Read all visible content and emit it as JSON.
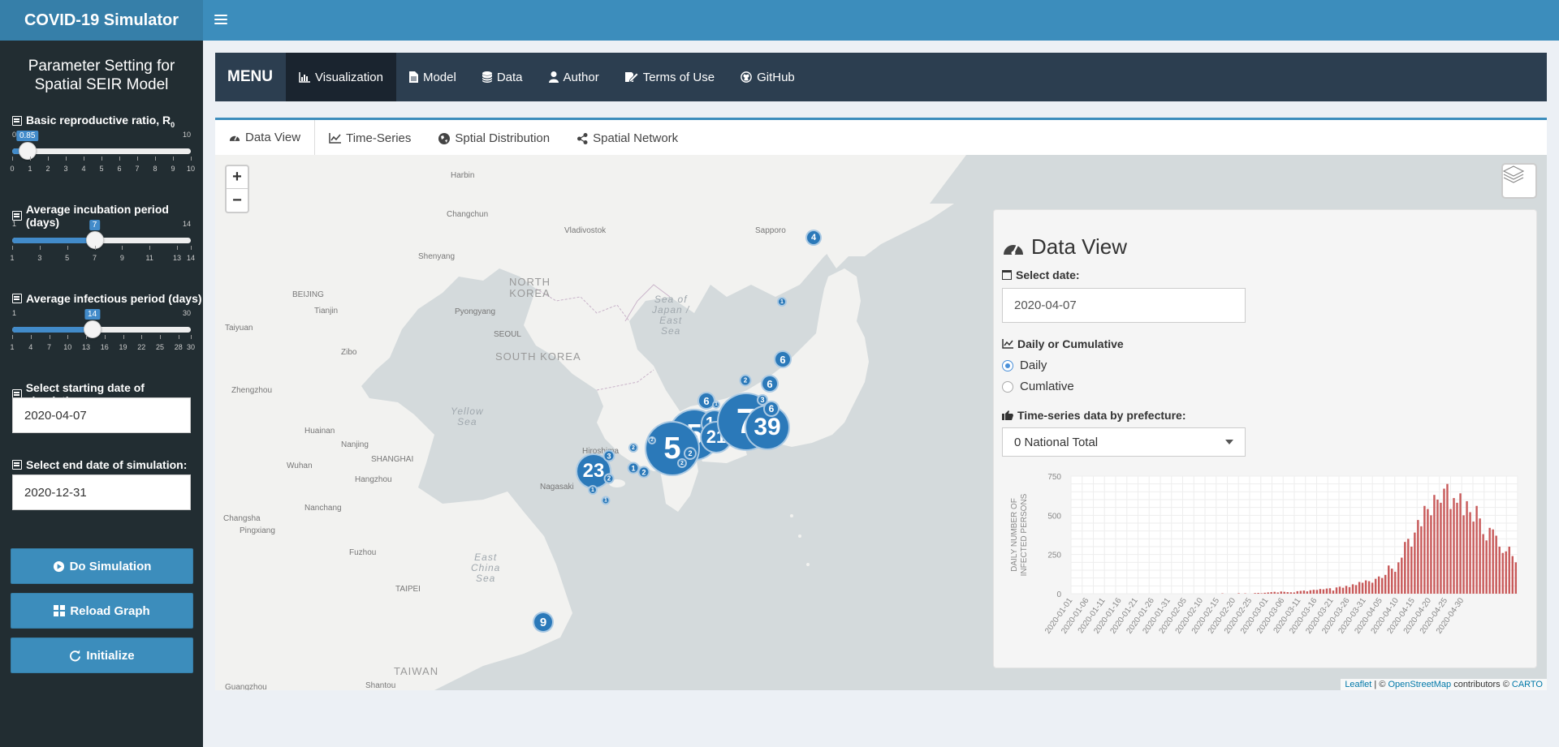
{
  "app": {
    "title": "COVID-19 Simulator"
  },
  "sidebar": {
    "title_line1": "Parameter Setting for",
    "title_line2": "Spatial SEIR Model",
    "r0": {
      "label": "Basic reproductive ratio, R",
      "label_sub": "0",
      "min": 0,
      "max": 10,
      "value": 0.85,
      "value_text": "0.85",
      "tick_labels": [
        "0",
        "1",
        "2",
        "3",
        "4",
        "5",
        "6",
        "7",
        "8",
        "9",
        "10"
      ],
      "min_text": "0",
      "max_text": "10"
    },
    "incubation": {
      "label": "Average incubation period (days)",
      "min": 1,
      "max": 14,
      "value": 7,
      "value_text": "7",
      "tick_labels": [
        "1",
        "3",
        "5",
        "7",
        "9",
        "11",
        "13",
        "14"
      ],
      "min_text": "1",
      "max_text": "14"
    },
    "infectious": {
      "label": "Average infectious period (days)",
      "min": 1,
      "max": 30,
      "value": 14,
      "value_text": "14",
      "tick_labels": [
        "1",
        "4",
        "7",
        "10",
        "13",
        "16",
        "19",
        "22",
        "25",
        "28",
        "30"
      ],
      "min_text": "1",
      "max_text": "30"
    },
    "start_date": {
      "label": "Select starting date of simulation:",
      "value": "2020-04-07"
    },
    "end_date": {
      "label": "Select end date of simulation:",
      "value": "2020-12-31"
    },
    "buttons": {
      "simulate": "Do Simulation",
      "reload": "Reload Graph",
      "initialize": "Initialize"
    }
  },
  "menu": {
    "brand": "MENU",
    "items": [
      {
        "label": "Visualization",
        "icon": "bar-chart-icon",
        "active": true
      },
      {
        "label": "Model",
        "icon": "file-icon"
      },
      {
        "label": "Data",
        "icon": "database-icon"
      },
      {
        "label": "Author",
        "icon": "user-icon"
      },
      {
        "label": "Terms of Use",
        "icon": "signature-icon"
      },
      {
        "label": "GitHub",
        "icon": "github-icon"
      }
    ]
  },
  "tabs": [
    {
      "label": "Data View",
      "icon": "dashboard-icon",
      "active": true
    },
    {
      "label": "Time-Series",
      "icon": "line-chart-icon"
    },
    {
      "label": "Sptial Distribution",
      "icon": "globe-icon"
    },
    {
      "label": "Spatial Network",
      "icon": "share-icon"
    }
  ],
  "map": {
    "labels": {
      "harbin": "Harbin",
      "changchun": "Changchun",
      "vladivostok": "Vladivostok",
      "sapporo": "Sapporo",
      "shenyang": "Shenyang",
      "beijing": "BEIJING",
      "tianjin": "Tianjin",
      "pyongyang": "Pyongyang",
      "north_korea_1": "NORTH",
      "north_korea_2": "KOREA",
      "seoul": "SEOUL",
      "south_korea": "SOUTH KOREA",
      "taiyuan": "Taiyuan",
      "zibo": "Zibo",
      "zhengzhou": "Zhengzhou",
      "huainan": "Huainan",
      "nanjing": "Nanjing",
      "shanghai": "SHANGHAI",
      "wuhan": "Wuhan",
      "hangzhou": "Hangzhou",
      "nanchang": "Nanchang",
      "changsha": "Changsha",
      "pingxiang": "Pingxiang",
      "fuzhou": "Fuzhou",
      "taipei": "TAIPEI",
      "taiwan": "TAIWAN",
      "shantou": "Shantou",
      "guangzhou": "Guangzhou",
      "nagasaki": "Nagasaki",
      "hiroshima": "Hiroshima",
      "sea_japan_1": "Sea of",
      "sea_japan_2": "Japan /",
      "sea_japan_3": "East",
      "sea_japan_4": "Sea",
      "yellow_1": "Yellow",
      "yellow_2": "Sea",
      "ecs_1": "East",
      "ecs_2": "China",
      "ecs_3": "Sea"
    },
    "clusters": [
      "4",
      "1",
      "6",
      "2",
      "6",
      "3",
      "6",
      "6",
      "1",
      "6",
      "14",
      "5",
      "21",
      "7",
      "39",
      "1",
      "5",
      "3",
      "23",
      "3",
      "2",
      "1",
      "2",
      "2",
      "1",
      "2",
      "2",
      "9"
    ],
    "attribution": {
      "leaflet": "Leaflet",
      "sep": " | © ",
      "osm": "OpenStreetMap",
      "contrib": " contributors © ",
      "carto": "CARTO"
    }
  },
  "data_view": {
    "title": "Data View",
    "select_date_label": "Select date:",
    "select_date_value": "2020-04-07",
    "daily_or_cum_label": "Daily or Cumulative",
    "options": [
      "Daily",
      "Cumlative"
    ],
    "selected_option": "Daily",
    "timeseries_label": "Time-series data by prefecture:",
    "prefecture_value": "0 National Total"
  },
  "chart_data": {
    "type": "bar",
    "ylabel": "DAILY NUMBER OF INFECTED PERSONS",
    "ylim": [
      0,
      750
    ],
    "yticks": [
      0,
      250,
      500,
      750
    ],
    "grid": true,
    "color": "#c85a5a",
    "x_tick_labels": [
      "2020-01-01",
      "2020-01-06",
      "2020-01-11",
      "2020-01-16",
      "2020-01-21",
      "2020-01-26",
      "2020-01-31",
      "2020-02-05",
      "2020-02-10",
      "2020-02-15",
      "2020-02-20",
      "2020-02-25",
      "2020-03-01",
      "2020-03-06",
      "2020-03-11",
      "2020-03-16",
      "2020-03-21",
      "2020-03-26",
      "2020-03-31",
      "2020-04-05",
      "2020-04-10",
      "2020-04-15",
      "2020-04-20",
      "2020-04-25",
      "2020-04-30"
    ],
    "start_date": "2020-01-01",
    "values": [
      0,
      0,
      0,
      0,
      0,
      0,
      0,
      0,
      0,
      0,
      0,
      0,
      0,
      0,
      0,
      0,
      0,
      0,
      0,
      0,
      0,
      0,
      0,
      0,
      0,
      0,
      0,
      0,
      0,
      0,
      0,
      0,
      0,
      0,
      0,
      0,
      0,
      0,
      0,
      0,
      0,
      0,
      0,
      0,
      0,
      0,
      2,
      0,
      0,
      0,
      0,
      3,
      0,
      2,
      0,
      0,
      4,
      5,
      3,
      6,
      8,
      10,
      12,
      8,
      14,
      12,
      10,
      9,
      8,
      16,
      18,
      20,
      15,
      22,
      25,
      24,
      30,
      28,
      33,
      35,
      20,
      40,
      45,
      38,
      50,
      42,
      60,
      55,
      75,
      70,
      85,
      80,
      70,
      95,
      110,
      100,
      120,
      180,
      160,
      140,
      200,
      230,
      330,
      350,
      300,
      390,
      470,
      430,
      560,
      540,
      500,
      630,
      600,
      580,
      670,
      700,
      540,
      610,
      580,
      640,
      500,
      590,
      520,
      460,
      560,
      480,
      380,
      340,
      420,
      410,
      370,
      300,
      260,
      270,
      300,
      240,
      200
    ]
  }
}
